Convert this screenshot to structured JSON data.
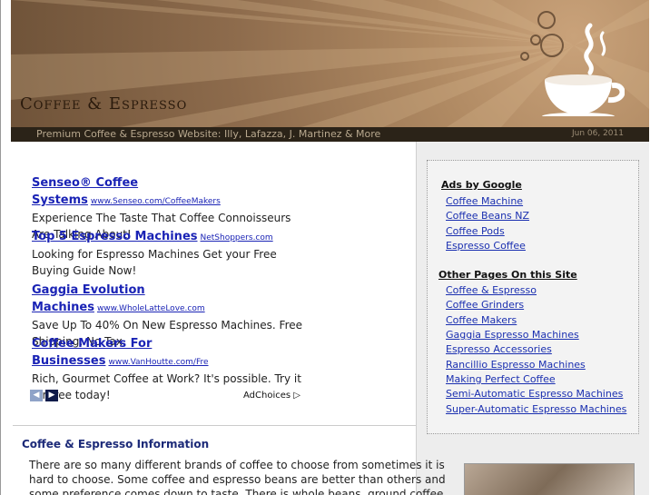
{
  "header": {
    "site_title": "Coffee & Espresso",
    "tagline": "Premium Coffee & Espresso Website: Illy, Lafazza, J. Martinez & More",
    "date": "Jun 06, 2011"
  },
  "ads": [
    {
      "title": "Senseo® Coffee Systems",
      "url": "www.Senseo.com/CoffeeMakers",
      "description": "Experience The Taste That Coffee Connoisseurs Are Talking About!"
    },
    {
      "title": "Top 5 Espresso Machines",
      "url": "NetShoppers.com",
      "description": "Looking for Espresso Machines Get your Free Buying Guide Now!"
    },
    {
      "title": "Gaggia Evolution Machines",
      "url": "www.WholeLatteLove.com",
      "description": "Save Up To 40% On New Espresso Machines. Free Shipping, No Tax."
    },
    {
      "title": "Coffee Makers For Businesses",
      "url": "www.VanHoutte.com/Fre",
      "description": "Rich, Gourmet Coffee at Work? It's possible. Try it for free today!"
    }
  ],
  "ad_nav": {
    "prev": "◀",
    "next": "▶"
  },
  "adchoices_label": "AdChoices ▷",
  "sidebar": {
    "ads_heading": "Ads by Google",
    "ads_links": [
      "Coffee Machine",
      "Coffee Beans NZ",
      "Coffee Pods",
      "Espresso Coffee"
    ],
    "pages_heading": "Other Pages On this Site",
    "pages_links": [
      "Coffee & Espresso",
      "Coffee Grinders",
      "Coffee Makers",
      "Gaggia Espresso Machines",
      "Espresso Accessories",
      "Rancillio Espresso Machines",
      "Making Perfect Coffee",
      "Semi-Automatic Espresso Machines",
      "Super-Automatic Espresso Machines"
    ]
  },
  "main": {
    "section_heading": "Coffee & Espresso Information",
    "body": "There are so many different brands of coffee to choose from sometimes it is hard to choose. Some coffee and espresso beans are better than others and some preference comes down to taste. There is whole beans, ground coffee and ESE"
  },
  "colors": {
    "link": "#1a23b5",
    "header_dark": "#2b2318",
    "heading": "#1c2a78"
  },
  "icons": {
    "cup": "coffee-cup-icon"
  }
}
